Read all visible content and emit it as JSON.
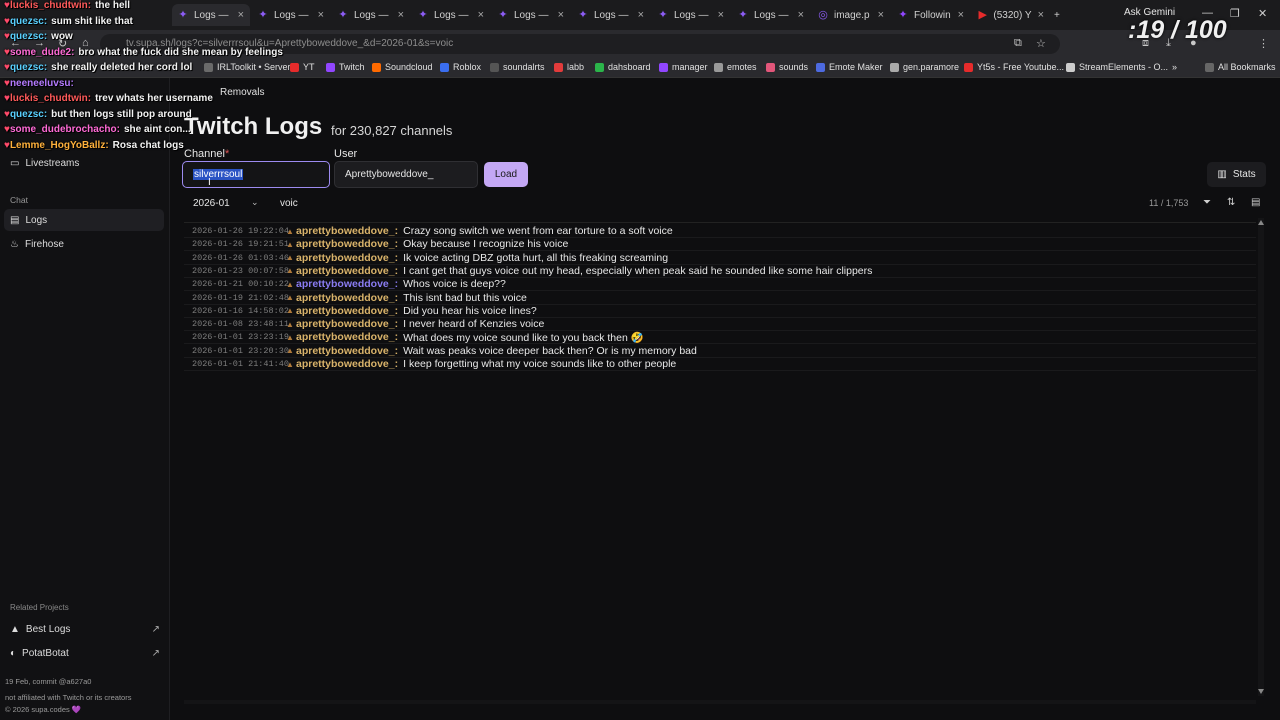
{
  "browser": {
    "tabs": [
      {
        "label": "Logs —",
        "active": true
      },
      {
        "label": "Logs — "
      },
      {
        "label": "Logs — "
      },
      {
        "label": "Logs — "
      },
      {
        "label": "Logs — "
      },
      {
        "label": "Logs — "
      },
      {
        "label": "Logs — "
      },
      {
        "label": "Logs — "
      },
      {
        "label": "image.p"
      },
      {
        "label": "Followin"
      },
      {
        "label": "(5320) Y"
      }
    ],
    "new_tab": "+",
    "ask_gemini": "Ask Gemini",
    "url": "tv.supa.sh/logs?c=silverrrsoul&u=Aprettyboweddove_&d=2026-01&s=voic",
    "bookmarks": [
      {
        "label": "IRLToolkit • Server",
        "color": "#6a6a6a"
      },
      {
        "label": "YT",
        "color": "#e62b2b"
      },
      {
        "label": "Twitch",
        "color": "#9146ff"
      },
      {
        "label": "Soundcloud",
        "color": "#ff6a00"
      },
      {
        "label": "Roblox",
        "color": "#3a6ef0"
      },
      {
        "label": "soundalrts",
        "color": "#555555"
      },
      {
        "label": "labb",
        "color": "#e23b3b"
      },
      {
        "label": "dahsboard",
        "color": "#2bb44a"
      },
      {
        "label": "manager",
        "color": "#9146ff"
      },
      {
        "label": "emotes",
        "color": "#999999"
      },
      {
        "label": "sounds",
        "color": "#e2567a"
      },
      {
        "label": "Emote Maker",
        "color": "#4d6ae0"
      },
      {
        "label": "gen.paramore",
        "color": "#aaaaaa"
      },
      {
        "label": "Yt5s - Free Youtube...",
        "color": "#e62b2b"
      },
      {
        "label": "StreamElements - O...",
        "color": "#cccccc"
      },
      {
        "label": "»",
        "color": "transparent"
      },
      {
        "label": "All Bookmarks",
        "color": "#666666"
      }
    ]
  },
  "sidebar": {
    "partial_item": "Removals",
    "livestreams": "Livestreams",
    "chat_section": "Chat",
    "logs": "Logs",
    "firehose": "Firehose",
    "related_section": "Related Projects",
    "best_logs": "Best Logs",
    "potatbotat": "PotatBotat",
    "commit": "19 Feb, commit @a627a0",
    "disclaimer": "not affiliated with Twitch or its creators",
    "copyright": "© 2026 supa.codes 💜"
  },
  "main": {
    "title": "Twitch Logs",
    "subtitle": "for 230,827 channels",
    "channel_label": "Channel",
    "required_mark": "*",
    "channel_value": "silverrrsoul",
    "user_label": "User",
    "user_value": "Aprettyboweddove_",
    "load_button": "Load",
    "stats_button": "Stats",
    "month": "2026-01",
    "search_value": "voic",
    "count": "11 / 1,753"
  },
  "logs": [
    {
      "ts": "2026-01-26 19:22:04",
      "user": "aprettyboweddove_:",
      "msg": "Crazy song switch we went from ear torture to a soft voice",
      "alt": false
    },
    {
      "ts": "2026-01-26 19:21:51",
      "user": "aprettyboweddove_:",
      "msg": "Okay because I recognize his voice",
      "alt": false
    },
    {
      "ts": "2026-01-26 01:03:46",
      "user": "aprettyboweddove_:",
      "msg": "Ik voice acting DBZ gotta hurt, all this freaking screaming",
      "alt": false
    },
    {
      "ts": "2026-01-23 00:07:58",
      "user": "aprettyboweddove_:",
      "msg": "I cant get that guys voice out my head, especially when peak said he sounded like some hair clippers",
      "alt": false
    },
    {
      "ts": "2026-01-21 00:10:22",
      "user": "aprettyboweddove_:",
      "msg": "Whos voice is deep??",
      "alt": true
    },
    {
      "ts": "2026-01-19 21:02:48",
      "user": "aprettyboweddove_:",
      "msg": "This isnt bad but this voice",
      "alt": false
    },
    {
      "ts": "2026-01-16 14:58:02",
      "user": "aprettyboweddove_:",
      "msg": "Did you hear his voice lines?",
      "alt": false
    },
    {
      "ts": "2026-01-08 23:48:11",
      "user": "aprettyboweddove_:",
      "msg": "I never heard of Kenzies voice",
      "alt": false
    },
    {
      "ts": "2026-01-01 23:23:19",
      "user": "aprettyboweddove_:",
      "msg": "What does my voice sound like to you back then 🤣",
      "alt": false
    },
    {
      "ts": "2026-01-01 23:20:30",
      "user": "aprettyboweddove_:",
      "msg": "Wait was peaks voice deeper back then? Or is my memory bad",
      "alt": false
    },
    {
      "ts": "2026-01-01 21:41:40",
      "user": "aprettyboweddove_:",
      "msg": "I keep forgetting what my voice sounds like to other people",
      "alt": false
    }
  ],
  "overlay": {
    "counter": ":19 / 100",
    "chat": [
      {
        "name": "luckis_chudtwin:",
        "text": "the hell",
        "color": "#ff5a5a"
      },
      {
        "name": "quezsc:",
        "text": "sum shit like that",
        "color": "#5ad1ff"
      },
      {
        "name": "quezsc:",
        "text": "wow",
        "color": "#5ad1ff"
      },
      {
        "name": "some_dude2:",
        "text": "bro what the fuck did she mean by feelings",
        "color": "#ff6bd6"
      },
      {
        "name": "quezsc:",
        "text": "she really deleted her cord lol",
        "color": "#5ad1ff"
      },
      {
        "name": "neeneeluvsu:",
        "text": "",
        "color": "#b57bff"
      },
      {
        "name": "luckis_chudtwin:",
        "text": "trev whats her username",
        "color": "#ff5a5a"
      },
      {
        "name": "quezsc:",
        "text": "but then logs still pop around",
        "color": "#5ad1ff"
      },
      {
        "name": "some_dudebrochacho:",
        "text": "she aint con...",
        "color": "#ff6bd6"
      },
      {
        "name": "Lemme_HogYoBallz:",
        "text": "Rosa chat logs",
        "color": "#ffb13b"
      }
    ]
  }
}
